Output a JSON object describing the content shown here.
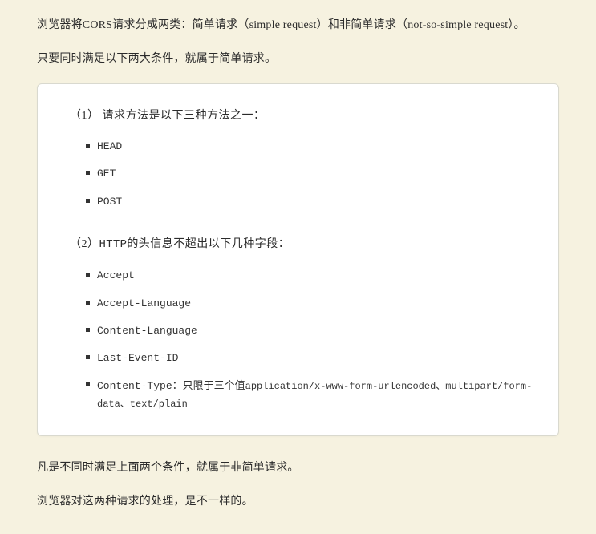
{
  "intro": {
    "p1": "浏览器将CORS请求分成两类：简单请求（simple request）和非简单请求（not-so-simple request）。",
    "p2": "只要同时满足以下两大条件，就属于简单请求。"
  },
  "card": {
    "section1": {
      "label": "（1） 请求方法是以下三种方法之一：",
      "items": [
        "HEAD",
        "GET",
        "POST"
      ]
    },
    "section2": {
      "label_prefix": "（2）",
      "label_mono": "HTTP",
      "label_suffix": "的头信息不超出以下几种字段：",
      "items": [
        "Accept",
        "Accept-Language",
        "Content-Language",
        "Last-Event-ID"
      ],
      "content_type": {
        "prefix": "Content-Type",
        "mid": "：只限于三个值",
        "values": "application/x-www-form-urlencoded、multipart/form-data、text/plain"
      }
    }
  },
  "outro": {
    "p1": "凡是不同时满足上面两个条件，就属于非简单请求。",
    "p2": "浏览器对这两种请求的处理，是不一样的。"
  }
}
